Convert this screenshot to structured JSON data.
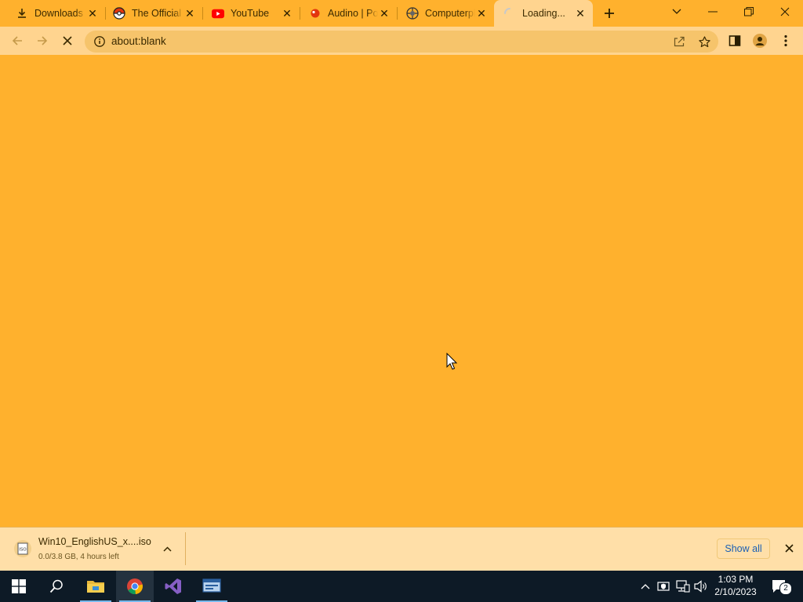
{
  "browser": {
    "tabs": [
      {
        "title": "Downloads",
        "favicon": "download-icon"
      },
      {
        "title": "The Official Pokémon Website",
        "favicon": "pokeball-icon"
      },
      {
        "title": "YouTube",
        "favicon": "youtube-icon"
      },
      {
        "title": "Audino | Pokédex",
        "favicon": "pokemon-icon"
      },
      {
        "title": "Computerphile",
        "favicon": "site-icon"
      },
      {
        "title": "Loading...",
        "favicon": "loading-spinner-icon",
        "active": true
      }
    ],
    "address": {
      "url": "about:blank"
    }
  },
  "download_shelf": {
    "item": {
      "filename": "Win10_EnglishUS_x....iso",
      "status": "0.0/3.8 GB, 4 hours left"
    },
    "show_all_label": "Show all"
  },
  "taskbar": {
    "clock": {
      "time": "1:03 PM",
      "date": "2/10/2023"
    },
    "notification_count": "2"
  },
  "colors": {
    "theme": "#ffb12d",
    "toolbar": "#ffd48f",
    "taskbar": "#0d1a26"
  }
}
